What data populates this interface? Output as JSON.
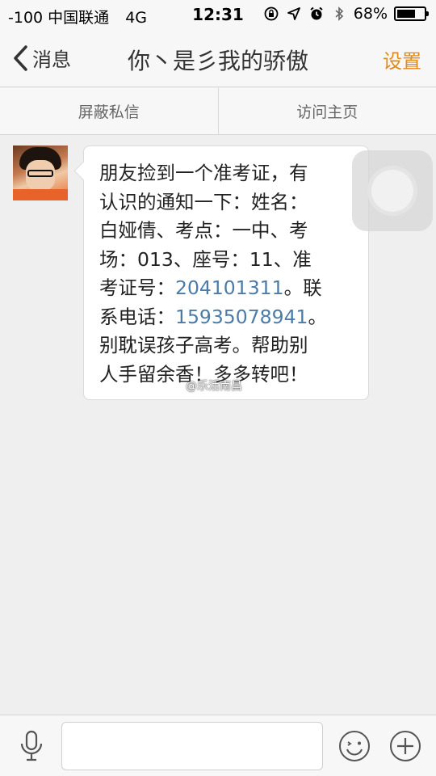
{
  "status_bar": {
    "carrier": "-100 中国联通",
    "network": "4G",
    "time": "12:31",
    "battery": "68%",
    "battery_level": 0.68
  },
  "nav": {
    "back_label": "消息",
    "title": "你丶是彡我的骄傲",
    "settings_label": "设置"
  },
  "actions": {
    "block_label": "屏蔽私信",
    "visit_label": "访问主页"
  },
  "message": {
    "lines": [
      {
        "pre": "朋友捡到一个准考证，有",
        "link": "",
        "post": ""
      },
      {
        "pre": "认识的通知一下：姓名：",
        "link": "",
        "post": ""
      },
      {
        "pre": "白娅倩、考点：一中、考",
        "link": "",
        "post": ""
      },
      {
        "pre": "场：013、座号：11、准",
        "link": "",
        "post": ""
      },
      {
        "pre": "考证号：",
        "link": "204101311",
        "post": "。联"
      },
      {
        "pre": "系电话：",
        "link": "15935078941",
        "post": "。"
      },
      {
        "pre": "别耽误孩子高考。帮助别",
        "link": "",
        "post": ""
      },
      {
        "pre": "人手留余香！多多转吧！",
        "link": "",
        "post": ""
      }
    ]
  },
  "watermark": "@乐活南昌",
  "input": {
    "value": "",
    "placeholder": ""
  },
  "colors": {
    "accent": "#e38a19",
    "link": "#4b7ba7",
    "background": "#efefef"
  },
  "icons": [
    "back-chevron-icon",
    "microphone-icon",
    "emoji-icon",
    "plus-icon",
    "lock-rotation-icon",
    "location-arrow-icon",
    "alarm-clock-icon",
    "bluetooth-icon"
  ]
}
